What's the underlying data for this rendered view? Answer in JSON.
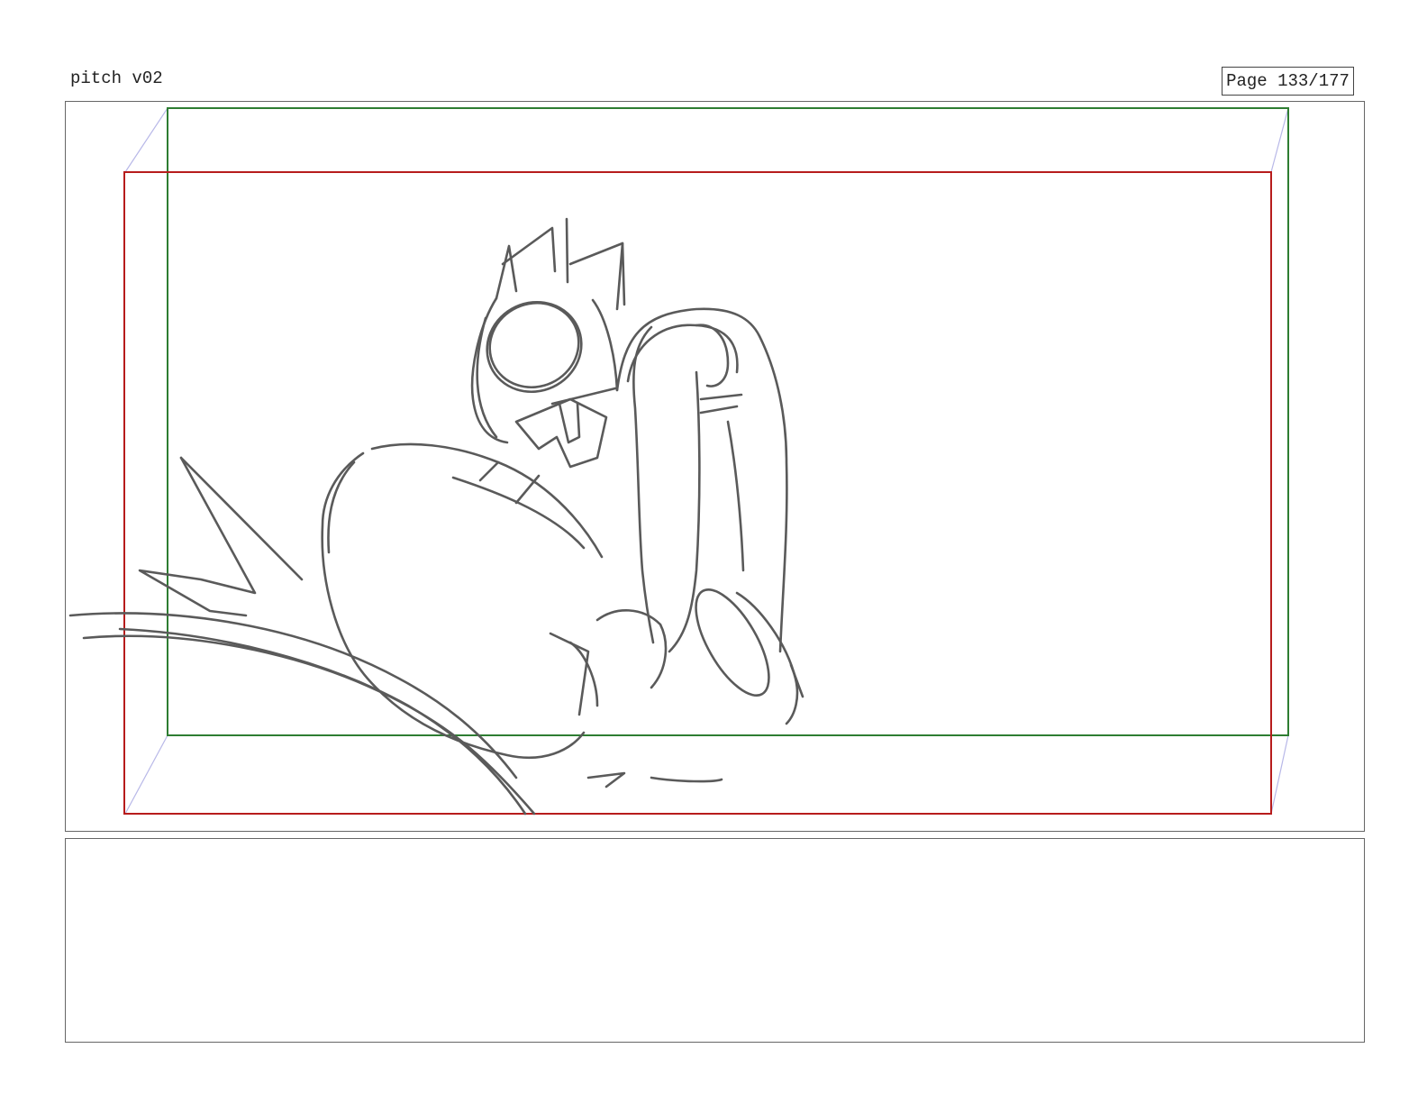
{
  "document": {
    "title": "pitch v02",
    "page_label": "Page 133/177"
  },
  "panel": {
    "guides": {
      "action_safe_color": "#2e7d32",
      "title_safe_color": "#b71c1c",
      "perspective_line_color": "#b8b8e8"
    },
    "sketch_color": "#5a5a5a"
  },
  "notes": {
    "text": ""
  }
}
